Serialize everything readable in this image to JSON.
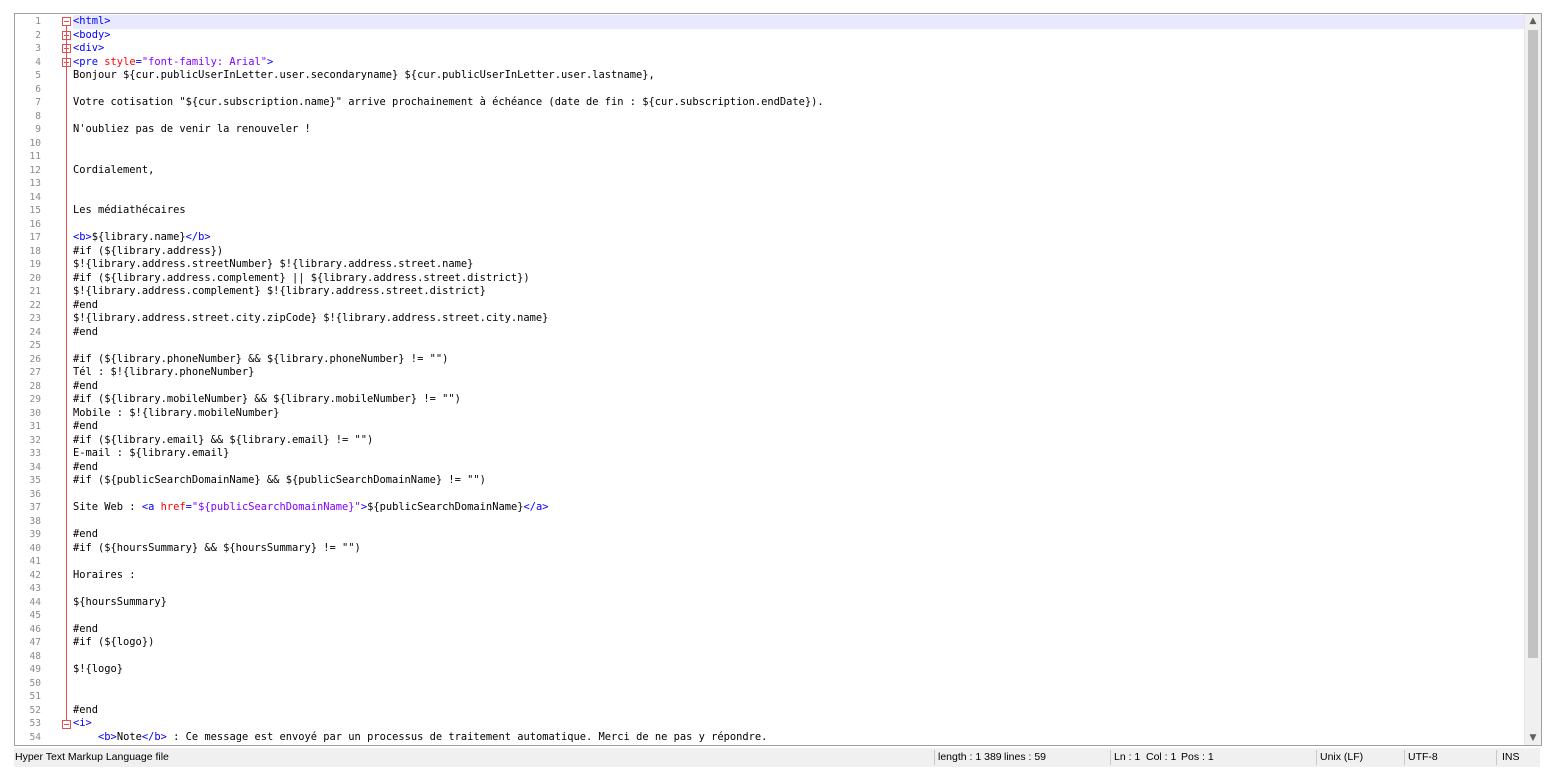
{
  "editor": {
    "lines": [
      {
        "n": "1",
        "t": "<html>"
      },
      {
        "n": "2",
        "t": "<body>"
      },
      {
        "n": "3",
        "t": "<div>"
      },
      {
        "n": "4",
        "t": "<pre style=\"font-family: Arial\">"
      },
      {
        "n": "5",
        "t": "Bonjour ${cur.publicUserInLetter.user.secondaryname} ${cur.publicUserInLetter.user.lastname},"
      },
      {
        "n": "6",
        "t": ""
      },
      {
        "n": "7",
        "t": "Votre cotisation \"${cur.subscription.name}\" arrive prochainement à échéance (date de fin : ${cur.subscription.endDate})."
      },
      {
        "n": "8",
        "t": ""
      },
      {
        "n": "9",
        "t": "N'oubliez pas de venir la renouveler !"
      },
      {
        "n": "10",
        "t": ""
      },
      {
        "n": "11",
        "t": ""
      },
      {
        "n": "12",
        "t": "Cordialement,"
      },
      {
        "n": "13",
        "t": ""
      },
      {
        "n": "14",
        "t": ""
      },
      {
        "n": "15",
        "t": "Les médiathécaires"
      },
      {
        "n": "16",
        "t": ""
      },
      {
        "n": "17",
        "t": "<b>${library.name}</b>"
      },
      {
        "n": "18",
        "t": "#if (${library.address})"
      },
      {
        "n": "19",
        "t": "$!{library.address.streetNumber} $!{library.address.street.name}"
      },
      {
        "n": "20",
        "t": "#if (${library.address.complement} || ${library.address.street.district})"
      },
      {
        "n": "21",
        "t": "$!{library.address.complement} $!{library.address.street.district}"
      },
      {
        "n": "22",
        "t": "#end"
      },
      {
        "n": "23",
        "t": "$!{library.address.street.city.zipCode} $!{library.address.street.city.name}"
      },
      {
        "n": "24",
        "t": "#end"
      },
      {
        "n": "25",
        "t": ""
      },
      {
        "n": "26",
        "t": "#if (${library.phoneNumber} && ${library.phoneNumber} != \"\")"
      },
      {
        "n": "27",
        "t": "Tél : $!{library.phoneNumber}"
      },
      {
        "n": "28",
        "t": "#end"
      },
      {
        "n": "29",
        "t": "#if (${library.mobileNumber} && ${library.mobileNumber} != \"\")"
      },
      {
        "n": "30",
        "t": "Mobile : $!{library.mobileNumber}"
      },
      {
        "n": "31",
        "t": "#end"
      },
      {
        "n": "32",
        "t": "#if (${library.email} && ${library.email} != \"\")"
      },
      {
        "n": "33",
        "t": "E-mail : ${library.email}"
      },
      {
        "n": "34",
        "t": "#end"
      },
      {
        "n": "35",
        "t": "#if (${publicSearchDomainName} && ${publicSearchDomainName} != \"\")"
      },
      {
        "n": "36",
        "t": ""
      },
      {
        "n": "37",
        "t": "Site Web : <a href=\"${publicSearchDomainName}\">${publicSearchDomainName}</a>"
      },
      {
        "n": "38",
        "t": ""
      },
      {
        "n": "39",
        "t": "#end"
      },
      {
        "n": "40",
        "t": "#if (${hoursSummary} && ${hoursSummary} != \"\")"
      },
      {
        "n": "41",
        "t": ""
      },
      {
        "n": "42",
        "t": "Horaires :"
      },
      {
        "n": "43",
        "t": ""
      },
      {
        "n": "44",
        "t": "${hoursSummary}"
      },
      {
        "n": "45",
        "t": ""
      },
      {
        "n": "46",
        "t": "#end"
      },
      {
        "n": "47",
        "t": "#if (${logo})"
      },
      {
        "n": "48",
        "t": ""
      },
      {
        "n": "49",
        "t": "$!{logo}"
      },
      {
        "n": "50",
        "t": ""
      },
      {
        "n": "51",
        "t": ""
      },
      {
        "n": "52",
        "t": "#end"
      },
      {
        "n": "53",
        "t": "<i>"
      },
      {
        "n": "54",
        "t": "    <b>Note</b> : Ce message est envoyé par un processus de traitement automatique. Merci de ne pas y répondre."
      }
    ]
  },
  "scrollbar": {
    "up_icon": "chevron-up-icon",
    "down_icon": "chevron-down-icon"
  },
  "status": {
    "file_type": "Hyper Text Markup Language file",
    "length": "length : 1 389",
    "lines": "lines : 59",
    "ln": "Ln : 1",
    "col": "Col : 1",
    "pos": "Pos : 1",
    "eol": "Unix (LF)",
    "encoding": "UTF-8",
    "mode": "INS"
  },
  "colors": {
    "tag": "#0000ff",
    "attr": "#ff0000",
    "string": "#8000ff",
    "current_line": "#e8e8ff",
    "fold": "#e05050"
  }
}
